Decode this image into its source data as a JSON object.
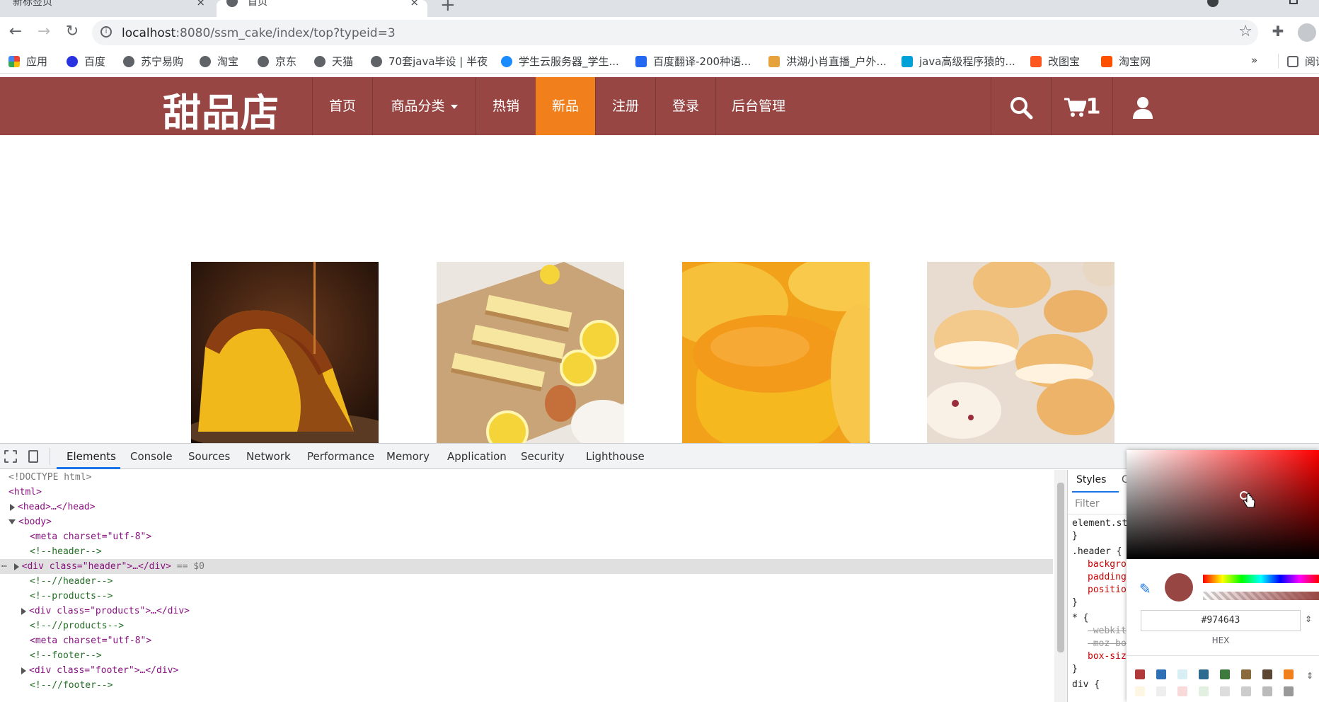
{
  "browser": {
    "tabs": [
      {
        "title": "新标签页"
      },
      {
        "title": "首页"
      }
    ],
    "new_tab_label": "+",
    "close_glyph": "×",
    "url_host": "localhost",
    "url_rest": ":8080/ssm_cake/index/top?typeid=3",
    "bookmarks": [
      {
        "label": "应用",
        "icon": "apps-grid-icon",
        "color": "#4285f4"
      },
      {
        "label": "百度",
        "icon": "baidu-paw-icon",
        "color": "#2932e1"
      },
      {
        "label": "苏宁易购",
        "icon": "globe-icon",
        "color": "#5f6368"
      },
      {
        "label": "淘宝",
        "icon": "globe-icon",
        "color": "#5f6368"
      },
      {
        "label": "京东",
        "icon": "globe-icon",
        "color": "#5f6368"
      },
      {
        "label": "天猫",
        "icon": "globe-icon",
        "color": "#5f6368"
      },
      {
        "label": "70套java毕设 | 半夜",
        "icon": "globe-icon",
        "color": "#5f6368"
      },
      {
        "label": "学生云服务器_学生...",
        "icon": "cloud-icon",
        "color": "#1a8cff"
      },
      {
        "label": "百度翻译-200种语...",
        "icon": "translate-icon",
        "color": "#2468f2"
      },
      {
        "label": "洪湖小肖直播_户外...",
        "icon": "live-icon",
        "color": "#e6a23c"
      },
      {
        "label": "java高级程序猿的...",
        "icon": "bilibili-icon",
        "color": "#00a1d6"
      },
      {
        "label": "改图宝",
        "icon": "gaitubao-icon",
        "color": "#ff5722"
      },
      {
        "label": "淘宝网",
        "icon": "taobao-icon",
        "color": "#ff5000"
      }
    ],
    "more_bookmarks": "»",
    "reading_list": "阅读"
  },
  "site": {
    "logo": "甜品店",
    "header_color": "#974643",
    "active_color": "#f07f1c",
    "nav": [
      {
        "label": "首页"
      },
      {
        "label": "商品分类"
      },
      {
        "label": "热销"
      },
      {
        "label": "新品"
      },
      {
        "label": "注册"
      },
      {
        "label": "登录"
      },
      {
        "label": "后台管理"
      }
    ],
    "cart_count": "1",
    "products": [
      {
        "name": "cheesecake-caramel",
        "alt": "product-1"
      },
      {
        "name": "lemon-cheesecake-bars",
        "alt": "product-2"
      },
      {
        "name": "orange-custard-cake",
        "alt": "product-3"
      },
      {
        "name": "cream-buns",
        "alt": "product-4"
      }
    ]
  },
  "devtools": {
    "tabs": [
      "Elements",
      "Console",
      "Sources",
      "Network",
      "Performance",
      "Memory",
      "Application",
      "Security",
      "Lighthouse"
    ],
    "dom_lines": [
      "<!DOCTYPE html>",
      "<html>",
      "<head>…</head>",
      "<body>",
      "<meta charset=\"utf-8\">",
      "<!--header-->",
      "<div class=\"header\">…</div>",
      " == $0",
      "<!--//header-->",
      "<!--products-->",
      "<div class=\"products\">…</div>",
      "<!--//products-->",
      "<meta charset=\"utf-8\">",
      "<!--footer-->",
      "<div class=\"footer\">…</div>",
      "<!--//footer-->"
    ],
    "styles_tab": "Styles",
    "styles_tab2": "C",
    "filter_placeholder": "Filter",
    "styles_lines": [
      "element.st",
      "}",
      ".header {",
      "backgro",
      "padding",
      "positio",
      "}",
      "* {",
      "-webkit",
      "-moz-bo",
      "box-siz",
      "}",
      "div {"
    ],
    "color_picker": {
      "hex_value": "#974643",
      "format_label": "HEX",
      "palette": [
        "#b03a3a",
        "#2f6fb5",
        "#d8eef5",
        "#2d6a8f",
        "#3d7a3d",
        "#8a6a3a",
        "#5a4632",
        "#f07f1c",
        "#fdf6e3",
        "#eeeeee",
        "#f8dada",
        "#e2f0e2",
        "#dddddd",
        "#cccccc",
        "#bbbbbb",
        "#999999"
      ]
    }
  }
}
